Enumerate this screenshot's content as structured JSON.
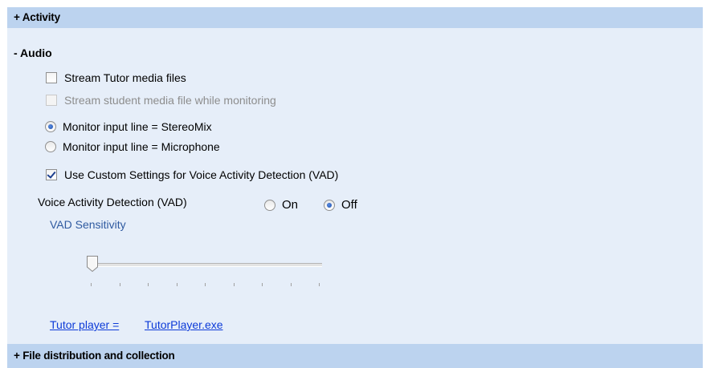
{
  "sections": {
    "activity": {
      "label": "+ Activity"
    },
    "audio": {
      "label": "- Audio"
    },
    "file_distribution": {
      "label": "+ File distribution and collection"
    }
  },
  "audio": {
    "stream_tutor": {
      "label": "Stream Tutor media files",
      "checked": false
    },
    "stream_student": {
      "label": "Stream student media file while monitoring",
      "checked": false,
      "disabled": true
    },
    "monitor_input": {
      "options": [
        {
          "label": "Monitor input line = StereoMix",
          "selected": true
        },
        {
          "label": "Monitor input line = Microphone",
          "selected": false
        }
      ]
    },
    "custom_vad": {
      "label": "Use Custom Settings for Voice Activity Detection (VAD)",
      "checked": true
    },
    "vad": {
      "label": "Voice Activity Detection (VAD)",
      "on_label": "On",
      "off_label": "Off",
      "selected": "Off",
      "sensitivity_label": "VAD Sensitivity",
      "sensitivity_value": 0,
      "tick_count": 9
    },
    "tutor_player": {
      "label": "Tutor player =",
      "value": "TutorPlayer.exe"
    }
  },
  "colors": {
    "header_bg": "#bcd3ef",
    "panel_bg": "#e6eef9",
    "link": "#0c3ad8",
    "accent_label": "#2f5aa0"
  }
}
